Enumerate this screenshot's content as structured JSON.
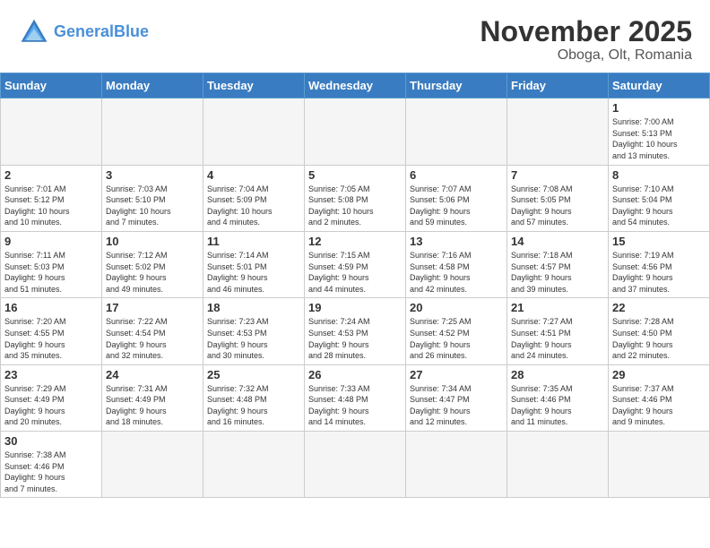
{
  "header": {
    "logo_general": "General",
    "logo_blue": "Blue",
    "month": "November 2025",
    "location": "Oboga, Olt, Romania"
  },
  "days_of_week": [
    "Sunday",
    "Monday",
    "Tuesday",
    "Wednesday",
    "Thursday",
    "Friday",
    "Saturday"
  ],
  "weeks": [
    [
      {
        "day": "",
        "info": ""
      },
      {
        "day": "",
        "info": ""
      },
      {
        "day": "",
        "info": ""
      },
      {
        "day": "",
        "info": ""
      },
      {
        "day": "",
        "info": ""
      },
      {
        "day": "",
        "info": ""
      },
      {
        "day": "1",
        "info": "Sunrise: 7:00 AM\nSunset: 5:13 PM\nDaylight: 10 hours\nand 13 minutes."
      }
    ],
    [
      {
        "day": "2",
        "info": "Sunrise: 7:01 AM\nSunset: 5:12 PM\nDaylight: 10 hours\nand 10 minutes."
      },
      {
        "day": "3",
        "info": "Sunrise: 7:03 AM\nSunset: 5:10 PM\nDaylight: 10 hours\nand 7 minutes."
      },
      {
        "day": "4",
        "info": "Sunrise: 7:04 AM\nSunset: 5:09 PM\nDaylight: 10 hours\nand 4 minutes."
      },
      {
        "day": "5",
        "info": "Sunrise: 7:05 AM\nSunset: 5:08 PM\nDaylight: 10 hours\nand 2 minutes."
      },
      {
        "day": "6",
        "info": "Sunrise: 7:07 AM\nSunset: 5:06 PM\nDaylight: 9 hours\nand 59 minutes."
      },
      {
        "day": "7",
        "info": "Sunrise: 7:08 AM\nSunset: 5:05 PM\nDaylight: 9 hours\nand 57 minutes."
      },
      {
        "day": "8",
        "info": "Sunrise: 7:10 AM\nSunset: 5:04 PM\nDaylight: 9 hours\nand 54 minutes."
      }
    ],
    [
      {
        "day": "9",
        "info": "Sunrise: 7:11 AM\nSunset: 5:03 PM\nDaylight: 9 hours\nand 51 minutes."
      },
      {
        "day": "10",
        "info": "Sunrise: 7:12 AM\nSunset: 5:02 PM\nDaylight: 9 hours\nand 49 minutes."
      },
      {
        "day": "11",
        "info": "Sunrise: 7:14 AM\nSunset: 5:01 PM\nDaylight: 9 hours\nand 46 minutes."
      },
      {
        "day": "12",
        "info": "Sunrise: 7:15 AM\nSunset: 4:59 PM\nDaylight: 9 hours\nand 44 minutes."
      },
      {
        "day": "13",
        "info": "Sunrise: 7:16 AM\nSunset: 4:58 PM\nDaylight: 9 hours\nand 42 minutes."
      },
      {
        "day": "14",
        "info": "Sunrise: 7:18 AM\nSunset: 4:57 PM\nDaylight: 9 hours\nand 39 minutes."
      },
      {
        "day": "15",
        "info": "Sunrise: 7:19 AM\nSunset: 4:56 PM\nDaylight: 9 hours\nand 37 minutes."
      }
    ],
    [
      {
        "day": "16",
        "info": "Sunrise: 7:20 AM\nSunset: 4:55 PM\nDaylight: 9 hours\nand 35 minutes."
      },
      {
        "day": "17",
        "info": "Sunrise: 7:22 AM\nSunset: 4:54 PM\nDaylight: 9 hours\nand 32 minutes."
      },
      {
        "day": "18",
        "info": "Sunrise: 7:23 AM\nSunset: 4:53 PM\nDaylight: 9 hours\nand 30 minutes."
      },
      {
        "day": "19",
        "info": "Sunrise: 7:24 AM\nSunset: 4:53 PM\nDaylight: 9 hours\nand 28 minutes."
      },
      {
        "day": "20",
        "info": "Sunrise: 7:25 AM\nSunset: 4:52 PM\nDaylight: 9 hours\nand 26 minutes."
      },
      {
        "day": "21",
        "info": "Sunrise: 7:27 AM\nSunset: 4:51 PM\nDaylight: 9 hours\nand 24 minutes."
      },
      {
        "day": "22",
        "info": "Sunrise: 7:28 AM\nSunset: 4:50 PM\nDaylight: 9 hours\nand 22 minutes."
      }
    ],
    [
      {
        "day": "23",
        "info": "Sunrise: 7:29 AM\nSunset: 4:49 PM\nDaylight: 9 hours\nand 20 minutes."
      },
      {
        "day": "24",
        "info": "Sunrise: 7:31 AM\nSunset: 4:49 PM\nDaylight: 9 hours\nand 18 minutes."
      },
      {
        "day": "25",
        "info": "Sunrise: 7:32 AM\nSunset: 4:48 PM\nDaylight: 9 hours\nand 16 minutes."
      },
      {
        "day": "26",
        "info": "Sunrise: 7:33 AM\nSunset: 4:48 PM\nDaylight: 9 hours\nand 14 minutes."
      },
      {
        "day": "27",
        "info": "Sunrise: 7:34 AM\nSunset: 4:47 PM\nDaylight: 9 hours\nand 12 minutes."
      },
      {
        "day": "28",
        "info": "Sunrise: 7:35 AM\nSunset: 4:46 PM\nDaylight: 9 hours\nand 11 minutes."
      },
      {
        "day": "29",
        "info": "Sunrise: 7:37 AM\nSunset: 4:46 PM\nDaylight: 9 hours\nand 9 minutes."
      }
    ],
    [
      {
        "day": "30",
        "info": "Sunrise: 7:38 AM\nSunset: 4:46 PM\nDaylight: 9 hours\nand 7 minutes."
      },
      {
        "day": "",
        "info": ""
      },
      {
        "day": "",
        "info": ""
      },
      {
        "day": "",
        "info": ""
      },
      {
        "day": "",
        "info": ""
      },
      {
        "day": "",
        "info": ""
      },
      {
        "day": "",
        "info": ""
      }
    ]
  ]
}
